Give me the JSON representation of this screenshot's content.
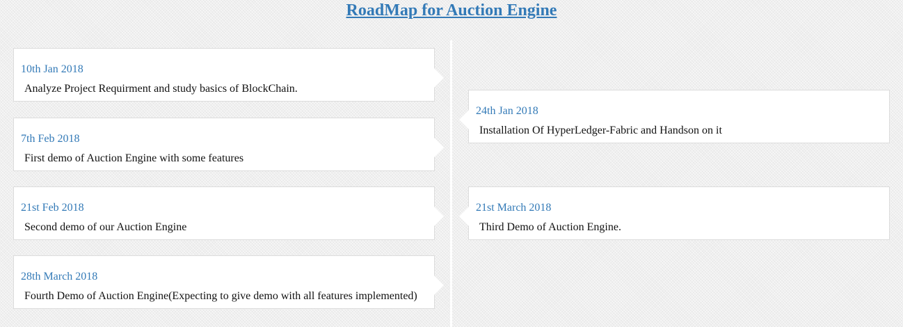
{
  "page": {
    "title": "RoadMap for Auction Engine"
  },
  "events": [
    {
      "side": "left",
      "date": "10th Jan 2018",
      "description": "Analyze Project Requirment and study basics of BlockChain."
    },
    {
      "side": "right",
      "date": "24th Jan 2018",
      "description": "Installation Of HyperLedger-Fabric and Handson on it"
    },
    {
      "side": "left",
      "date": "7th Feb 2018",
      "description": "First demo of Auction Engine with some features"
    },
    {
      "side": "left",
      "date": "21st Feb 2018",
      "description": "Second demo of our Auction Engine"
    },
    {
      "side": "right",
      "date": "21st March 2018",
      "description": "Third Demo of Auction Engine."
    },
    {
      "side": "left",
      "date": "28th March 2018",
      "description": "Fourth Demo of Auction Engine(Expecting to give demo with all features implemented)"
    }
  ],
  "colors": {
    "accent": "#337ab7",
    "card_background": "#ffffff",
    "text": "#111111"
  }
}
